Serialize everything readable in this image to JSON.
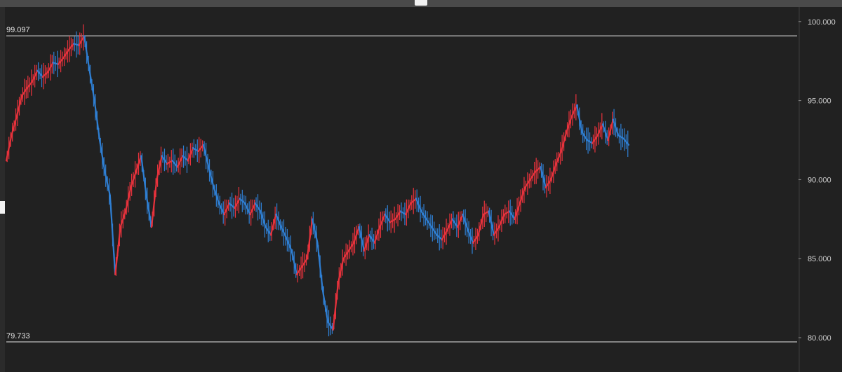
{
  "chart_data": {
    "type": "line",
    "title": "",
    "xlabel": "",
    "ylabel": "",
    "ylim": [
      79.733,
      100.0
    ],
    "y_ticks": [
      "100.000",
      "95.000",
      "90.000",
      "85.000",
      "80.000"
    ],
    "y_tick_values": [
      100,
      95,
      90,
      85,
      80
    ],
    "reference_lines": [
      {
        "label": "99.097",
        "value": 99.097
      },
      {
        "label": "79.733",
        "value": 79.733
      }
    ],
    "colors": {
      "up": "#e8323c",
      "down": "#2f7fd3",
      "background": "#212121",
      "reference": "#e6e6e6",
      "tick_text": "#cfcfcf"
    },
    "series": [
      {
        "values": [
          91.2,
          92.8,
          94.0,
          95.3,
          95.8,
          96.2,
          96.9,
          96.5,
          96.8,
          97.4,
          97.3,
          97.7,
          98.2,
          98.6,
          98.5,
          99.097,
          97.0,
          95.0,
          92.5,
          90.5,
          89.0,
          84.0,
          87.0,
          88.0,
          89.5,
          90.5,
          91.5,
          89.0,
          87.0,
          90.0,
          91.5,
          91.0,
          91.2,
          90.8,
          91.5,
          91.2,
          92.0,
          91.8,
          92.2,
          90.8,
          89.5,
          88.5,
          87.8,
          88.5,
          88.2,
          88.8,
          88.5,
          87.8,
          88.5,
          88.0,
          87.0,
          86.5,
          87.8,
          87.0,
          86.3,
          85.5,
          84.0,
          84.5,
          85.0,
          87.5,
          86.0,
          83.0,
          81.0,
          80.5,
          83.5,
          85.0,
          85.5,
          86.0,
          87.0,
          85.5,
          86.5,
          86.0,
          87.0,
          87.8,
          87.3,
          87.5,
          88.0,
          87.8,
          88.5,
          88.8,
          88.0,
          87.5,
          87.0,
          86.5,
          86.2,
          86.8,
          87.5,
          87.0,
          87.8,
          86.8,
          86.0,
          86.5,
          87.8,
          88.0,
          86.5,
          87.0,
          87.8,
          88.0,
          87.5,
          88.5,
          89.5,
          90.0,
          90.5,
          90.8,
          89.5,
          90.0,
          91.0,
          91.8,
          93.0,
          94.0,
          94.7,
          93.0,
          92.5,
          92.3,
          92.8,
          93.5,
          92.5,
          93.8,
          92.8,
          92.6,
          92.2
        ]
      }
    ]
  }
}
